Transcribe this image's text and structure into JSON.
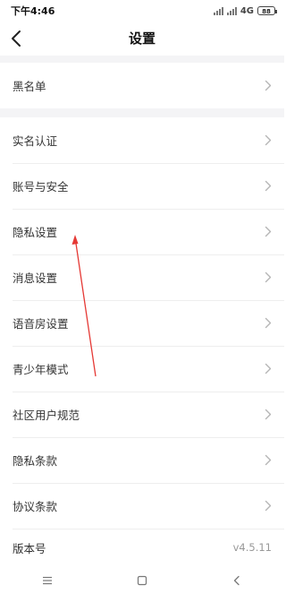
{
  "status_bar": {
    "time": "下午4:46",
    "network": "4G",
    "battery": "88"
  },
  "header": {
    "title": "设置"
  },
  "menu": {
    "items": [
      {
        "label": "黑名单"
      },
      {
        "label": "实名认证"
      },
      {
        "label": "账号与安全"
      },
      {
        "label": "隐私设置"
      },
      {
        "label": "消息设置"
      },
      {
        "label": "语音房设置"
      },
      {
        "label": "青少年模式"
      },
      {
        "label": "社区用户规范"
      },
      {
        "label": "隐私条款"
      },
      {
        "label": "协议条款"
      },
      {
        "label": "版本号",
        "value": "v4.5.11"
      }
    ]
  },
  "colors": {
    "background": "#ffffff",
    "section_gap": "#f4f4f6",
    "annotation_arrow": "#e53935"
  },
  "icons": {
    "back": "chevron-left-icon",
    "row": "chevron-right-icon",
    "sys_menu": "menu-icon",
    "sys_home": "square-icon",
    "sys_back": "triangle-back-icon"
  }
}
